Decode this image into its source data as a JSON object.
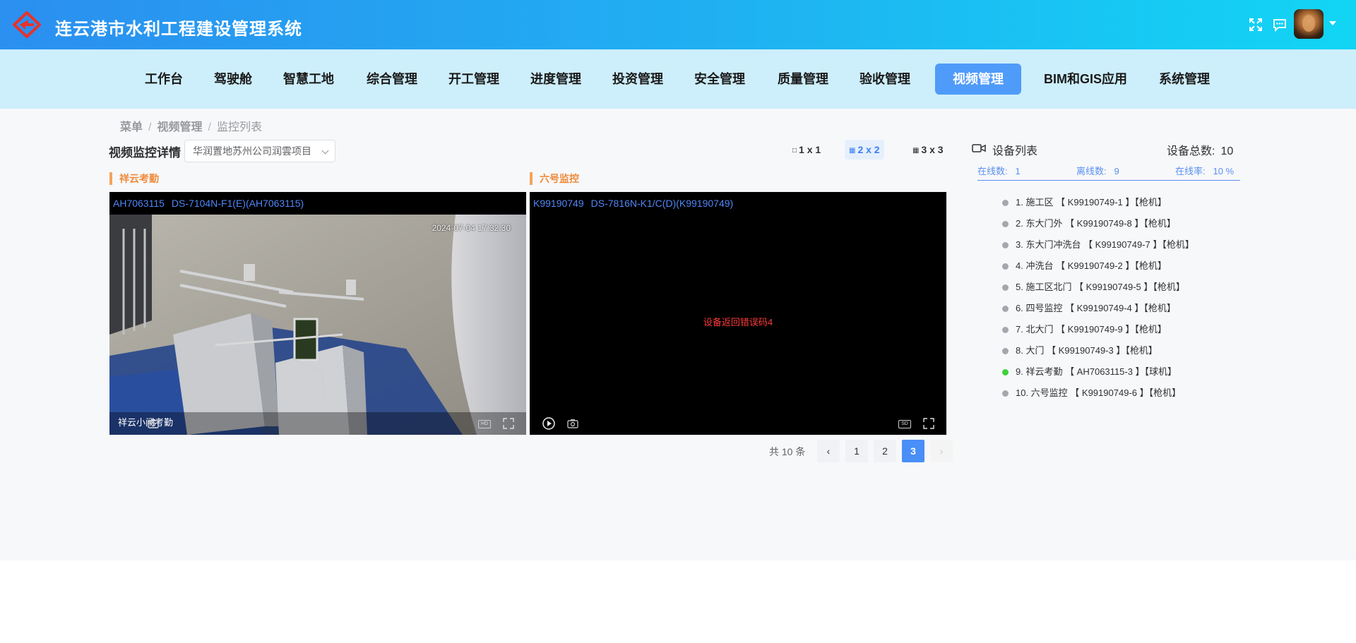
{
  "app": {
    "title": "连云港市水利工程建设管理系统"
  },
  "nav": {
    "items": [
      {
        "label": "工作台"
      },
      {
        "label": "驾驶舱"
      },
      {
        "label": "智慧工地"
      },
      {
        "label": "综合管理"
      },
      {
        "label": "开工管理"
      },
      {
        "label": "进度管理"
      },
      {
        "label": "投资管理"
      },
      {
        "label": "安全管理"
      },
      {
        "label": "质量管理"
      },
      {
        "label": "验收管理"
      },
      {
        "label": "视频管理"
      },
      {
        "label": "BIM和GIS应用"
      },
      {
        "label": "系统管理"
      }
    ],
    "active": "视频管理"
  },
  "breadcrumb": {
    "root": "菜单",
    "section": "视频管理",
    "page": "监控列表",
    "separator": "/"
  },
  "panel": {
    "label": "视频监控详情",
    "project_select": {
      "value": "华润置地苏州公司润雲项目"
    },
    "layouts": [
      {
        "label": "1 x 1"
      },
      {
        "label": "2 x 2"
      },
      {
        "label": "3 x 3"
      }
    ],
    "active_layout": "2 x 2"
  },
  "cameras": [
    {
      "title": "祥云考勤",
      "serial": "AH7063115",
      "model": "DS-7104N-F1(E)(AH7063115)",
      "osd_time": "2024-07-04 17:32:30",
      "osd_name": "祥云小闸考勤",
      "quality_badge": "HD"
    },
    {
      "title": "六号监控",
      "serial": "K99190749",
      "model": "DS-7816N-K1/C(D)(K99190749)",
      "error": "设备返回错误码4",
      "quality_badge": "SD"
    }
  ],
  "pagination": {
    "total_text": "共 10 条",
    "pages": [
      "1",
      "2",
      "3"
    ],
    "current": "3",
    "prev": "‹",
    "next": "›"
  },
  "device_panel": {
    "title": "设备列表",
    "total_label": "设备总数:",
    "total_value": "10",
    "online_label": "在线数:",
    "online_value": "1",
    "offline_label": "离线数:",
    "offline_value": "9",
    "rate_label": "在线率:",
    "rate_value": "10 %",
    "devices": [
      {
        "text": "1. 施工区 【 K99190749-1 】【枪机】",
        "online": false
      },
      {
        "text": "2. 东大门外 【 K99190749-8 】【枪机】",
        "online": false
      },
      {
        "text": "3. 东大门冲洗台 【 K99190749-7 】【枪机】",
        "online": false
      },
      {
        "text": "4. 冲洗台 【 K99190749-2 】【枪机】",
        "online": false
      },
      {
        "text": "5. 施工区北门 【 K99190749-5 】【枪机】",
        "online": false
      },
      {
        "text": "6. 四号监控 【 K99190749-4 】【枪机】",
        "online": false
      },
      {
        "text": "7. 北大门 【 K99190749-9 】【枪机】",
        "online": false
      },
      {
        "text": "8. 大门 【 K99190749-3 】【枪机】",
        "online": false
      },
      {
        "text": "9. 祥云考勤 【 AH7063115-3 】【球机】",
        "online": true
      },
      {
        "text": "10. 六号监控 【 K99190749-6 】【枪机】",
        "online": false
      }
    ]
  },
  "colors": {
    "header_start": "#2b8ff0",
    "header_end": "#12d5f4",
    "nav_bg": "#cdeefb",
    "accent": "#4f9bf9",
    "camera_title": "#ef8a3a",
    "online_dot": "#3fd13c",
    "offline_dot": "#a5a7ac",
    "error_text": "#ff3b3b"
  },
  "icons": {
    "logo": "logo-icon",
    "fullscreen": "fullscreen-icon",
    "message": "message-icon",
    "device": "camera-device-icon"
  }
}
